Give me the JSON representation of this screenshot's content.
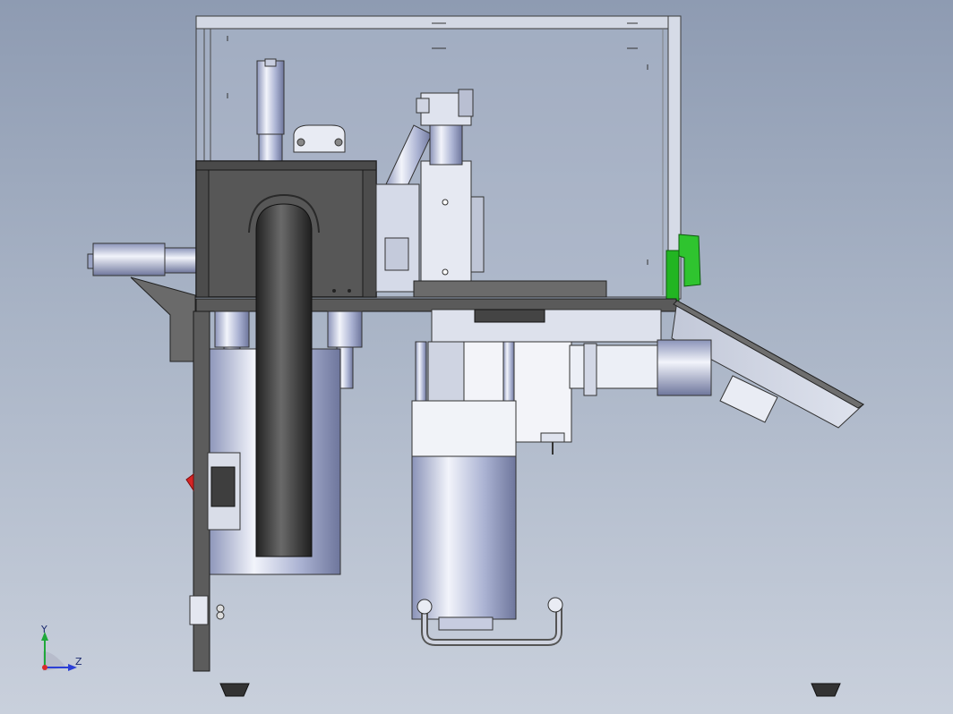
{
  "triad": {
    "y_label": "Y",
    "z_label": "Z",
    "y_color": "#1fa83a",
    "z_color": "#2b3fd6",
    "x_color": "#d92a2a"
  },
  "colors": {
    "background_top": "#8e9bb2",
    "background_bottom": "#c9d0dc",
    "dark_housing": "#555555",
    "light_steel": "#d7dcea",
    "highlight_green": "#22b522",
    "hose": "#3a3a3a"
  }
}
